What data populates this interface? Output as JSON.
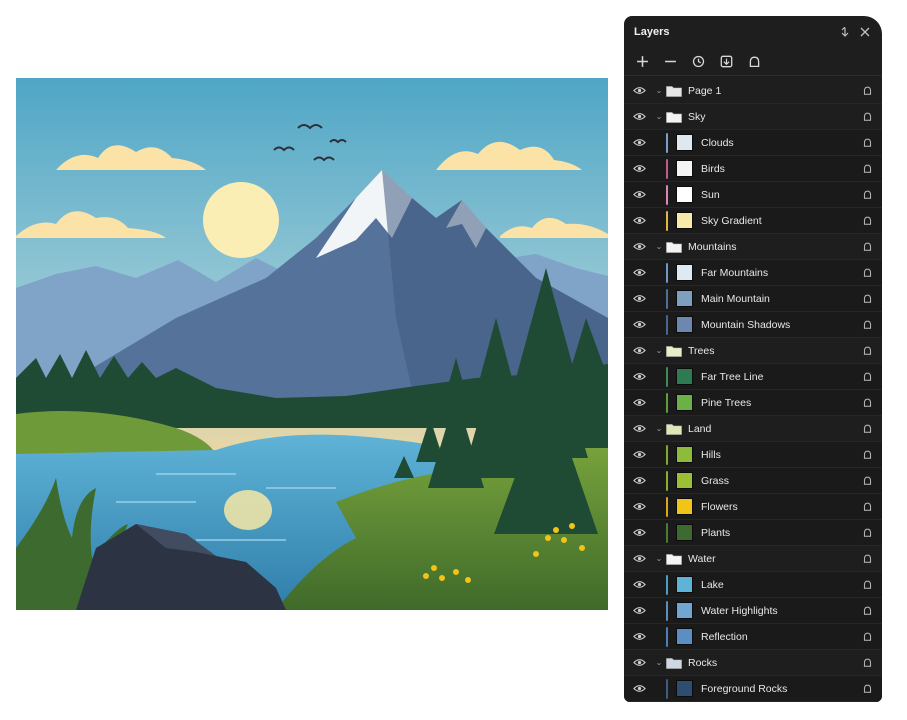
{
  "colors": {
    "panel_bg": "#1e1e1e",
    "sky_top": "#5fb3cf",
    "sky_horizon": "#f8d99a",
    "sun": "#fbeeb4",
    "lake": "#3f96bf",
    "grass": "#6f9a3a",
    "pine": "#1f4a34",
    "mountain": "#55739a",
    "snow": "#f2f5f8"
  },
  "panel": {
    "title": "Layers",
    "header_icons": [
      "collapse-icon",
      "close-icon"
    ],
    "toolbar": [
      "add-layer-icon",
      "remove-layer-icon",
      "history-icon",
      "import-icon",
      "lock-all-icon"
    ]
  },
  "layers": {
    "page": {
      "name": "Page 1"
    },
    "groups": [
      {
        "name": "Sky",
        "folder_color": "#f4f4f4",
        "children": [
          {
            "name": "Clouds",
            "swatch": "#dfe8ef",
            "bar": "#7aa0c8"
          },
          {
            "name": "Birds",
            "swatch": "#f5f5f5",
            "bar": "#c05a8a"
          },
          {
            "name": "Sun",
            "swatch": "#ffffff",
            "bar": "#d986b8"
          },
          {
            "name": "Sky Gradient",
            "swatch": "#f8eaa8",
            "bar": "#e0b640"
          }
        ]
      },
      {
        "name": "Mountains",
        "folder_color": "#f4f4f4",
        "children": [
          {
            "name": "Far Mountains",
            "swatch": "#dde9f3",
            "bar": "#6f97c8"
          },
          {
            "name": "Main Mountain",
            "swatch": "#7f9fc0",
            "bar": "#4d6f98"
          },
          {
            "name": "Mountain Shadows",
            "swatch": "#6c88ae",
            "bar": "#4a6690"
          }
        ]
      },
      {
        "name": "Trees",
        "folder_color": "#e9eec8",
        "children": [
          {
            "name": "Far Tree Line",
            "swatch": "#2e7a52",
            "bar": "#3c8a58"
          },
          {
            "name": "Pine Trees",
            "swatch": "#6db046",
            "bar": "#5e9e3a"
          }
        ]
      },
      {
        "name": "Land",
        "folder_color": "#dfe6b5",
        "children": [
          {
            "name": "Hills",
            "swatch": "#8ebc3a",
            "bar": "#7fa832"
          },
          {
            "name": "Grass",
            "swatch": "#9cbf36",
            "bar": "#88b030"
          },
          {
            "name": "Flowers",
            "swatch": "#f0c419",
            "bar": "#d8a816"
          },
          {
            "name": "Plants",
            "swatch": "#3d6a2e",
            "bar": "#4c7a34"
          }
        ]
      },
      {
        "name": "Water",
        "folder_color": "#f4f4f4",
        "children": [
          {
            "name": "Lake",
            "swatch": "#5fb3d6",
            "bar": "#4a9ec4"
          },
          {
            "name": "Water Highlights",
            "swatch": "#6fa6d4",
            "bar": "#5b8fbf"
          },
          {
            "name": "Reflection",
            "swatch": "#5a8fc4",
            "bar": "#4c7fb2"
          }
        ]
      },
      {
        "name": "Rocks",
        "folder_color": "#cfd8e2",
        "children": [
          {
            "name": "Foreground Rocks",
            "swatch": "#2f4d70",
            "bar": "#3c5c82"
          }
        ]
      }
    ]
  }
}
